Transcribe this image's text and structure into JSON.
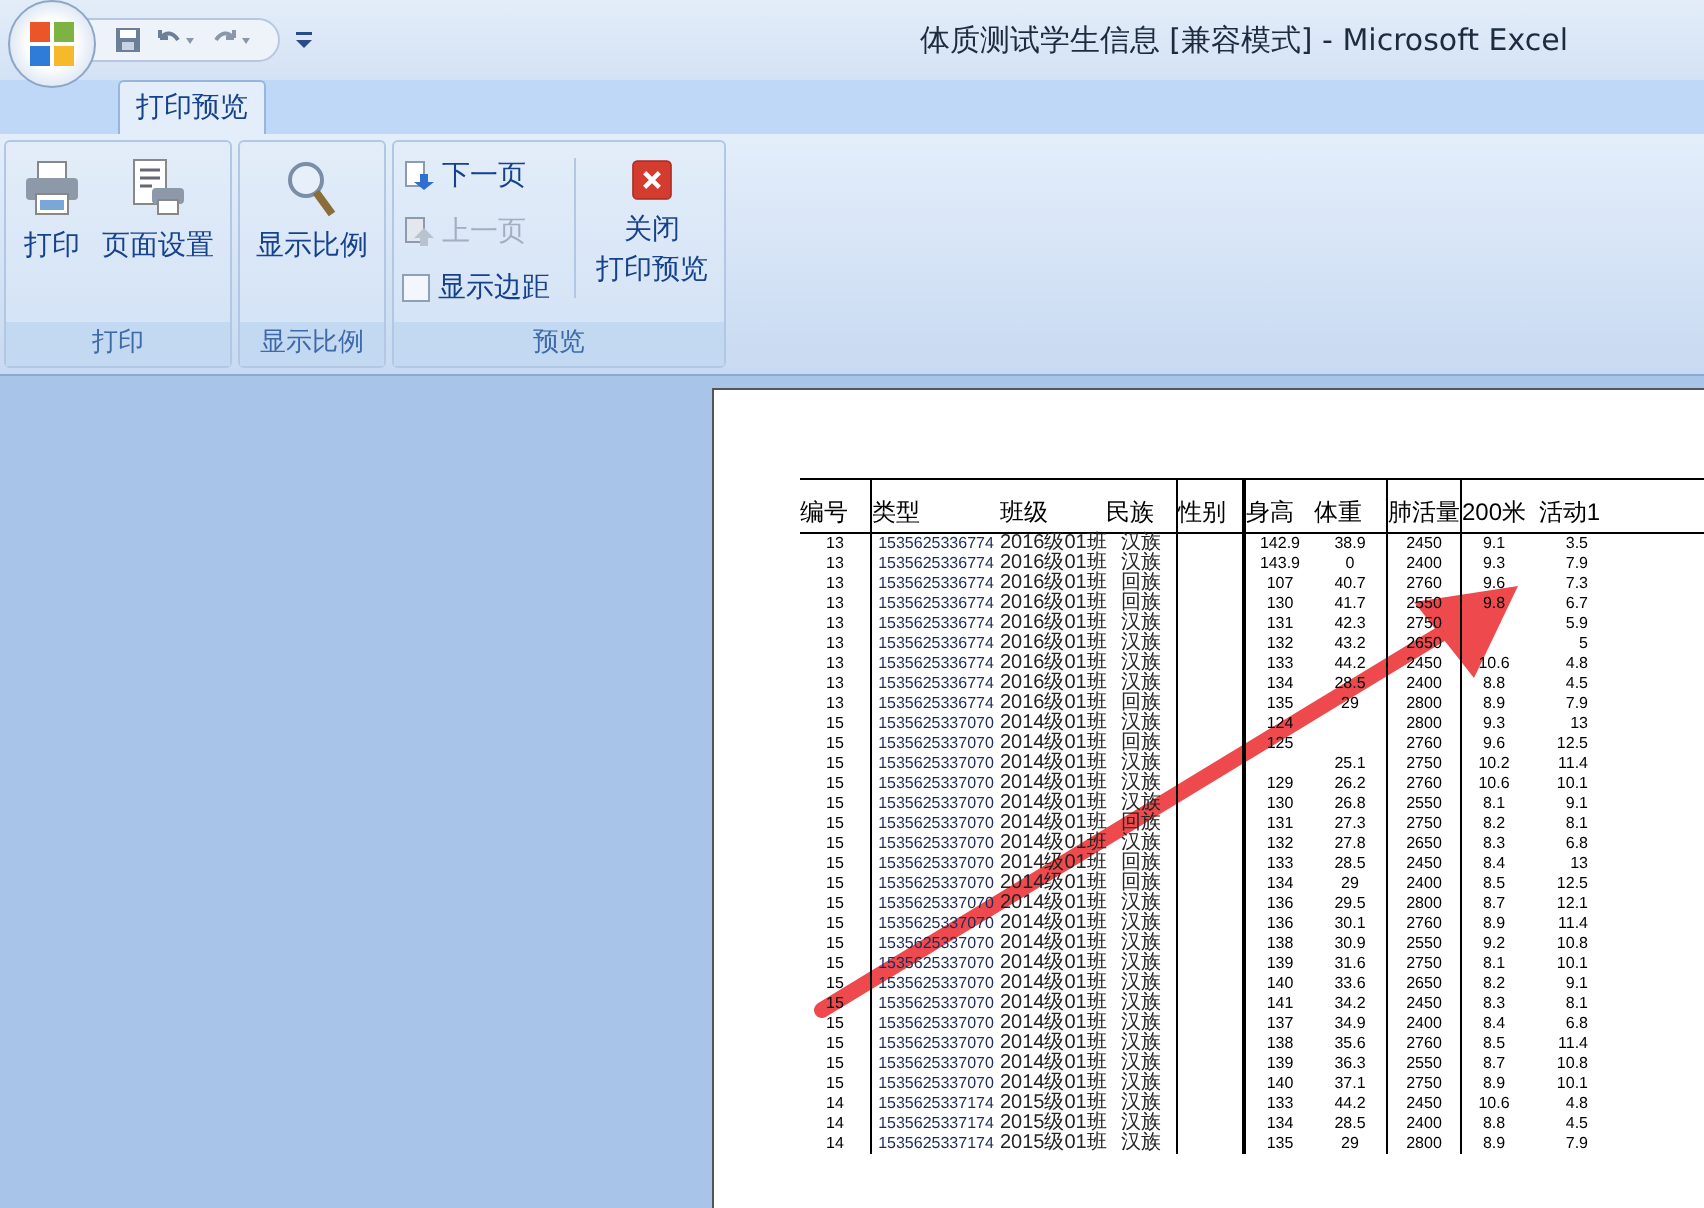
{
  "window": {
    "title": "体质测试学生信息  [兼容模式] - Microsoft Excel"
  },
  "tabs": [
    {
      "label": "打印预览",
      "selected": true
    }
  ],
  "ribbon": {
    "groups": [
      {
        "label": "打印",
        "buttons": [
          {
            "label": "打印",
            "kind": "print",
            "disabled": false
          },
          {
            "label": "页面设置",
            "kind": "page-setup",
            "disabled": false
          }
        ]
      },
      {
        "label": "显示比例",
        "buttons": [
          {
            "label": "显示比例",
            "kind": "zoom",
            "disabled": false
          }
        ]
      },
      {
        "label": "预览",
        "buttons": [
          {
            "label": "下一页",
            "kind": "next",
            "disabled": false
          },
          {
            "label": "上一页",
            "kind": "prev",
            "disabled": true
          },
          {
            "label": "显示边距",
            "kind": "checkbox",
            "checked": false
          },
          {
            "label_lines": [
              "关闭",
              "打印预览"
            ],
            "kind": "close",
            "disabled": false
          }
        ]
      }
    ]
  },
  "table": {
    "columns": [
      "编号",
      "类型",
      "班级",
      "民族",
      "性别",
      "身高",
      "体重",
      "肺活量",
      "200米",
      "活动1"
    ],
    "rows": [
      [
        "13",
        "1535625336774",
        "2016级01班",
        "汉族",
        null,
        "142.9",
        "38.9",
        "2450",
        "9.1",
        "3.5"
      ],
      [
        "13",
        "1535625336774",
        "2016级01班",
        "汉族",
        null,
        "143.9",
        "0",
        "2400",
        "9.3",
        "7.9"
      ],
      [
        "13",
        "1535625336774",
        "2016级01班",
        "回族",
        null,
        "107",
        "40.7",
        "2760",
        "9.6",
        "7.3"
      ],
      [
        "13",
        "1535625336774",
        "2016级01班",
        "回族",
        null,
        "130",
        "41.7",
        "2550",
        "9.8",
        "6.7"
      ],
      [
        "13",
        "1535625336774",
        "2016级01班",
        "汉族",
        null,
        "131",
        "42.3",
        "2750",
        null,
        "5.9"
      ],
      [
        "13",
        "1535625336774",
        "2016级01班",
        "汉族",
        null,
        "132",
        "43.2",
        "2650",
        null,
        "5"
      ],
      [
        "13",
        "1535625336774",
        "2016级01班",
        "汉族",
        null,
        "133",
        "44.2",
        "2450",
        "10.6",
        "4.8"
      ],
      [
        "13",
        "1535625336774",
        "2016级01班",
        "汉族",
        null,
        "134",
        "28.5",
        "2400",
        "8.8",
        "4.5"
      ],
      [
        "13",
        "1535625336774",
        "2016级01班",
        "回族",
        null,
        "135",
        "29",
        "2800",
        "8.9",
        "7.9"
      ],
      [
        "15",
        "1535625337070",
        "2014级01班",
        "汉族",
        null,
        "124",
        null,
        "2800",
        "9.3",
        "13"
      ],
      [
        "15",
        "1535625337070",
        "2014级01班",
        "回族",
        null,
        "125",
        null,
        "2760",
        "9.6",
        "12.5"
      ],
      [
        "15",
        "1535625337070",
        "2014级01班",
        "汉族",
        null,
        null,
        "25.1",
        "2750",
        "10.2",
        "11.4"
      ],
      [
        "15",
        "1535625337070",
        "2014级01班",
        "汉族",
        null,
        "129",
        "26.2",
        "2760",
        "10.6",
        "10.1"
      ],
      [
        "15",
        "1535625337070",
        "2014级01班",
        "汉族",
        null,
        "130",
        "26.8",
        "2550",
        "8.1",
        "9.1"
      ],
      [
        "15",
        "1535625337070",
        "2014级01班",
        "回族",
        null,
        "131",
        "27.3",
        "2750",
        "8.2",
        "8.1"
      ],
      [
        "15",
        "1535625337070",
        "2014级01班",
        "汉族",
        null,
        "132",
        "27.8",
        "2650",
        "8.3",
        "6.8"
      ],
      [
        "15",
        "1535625337070",
        "2014级01班",
        "回族",
        null,
        "133",
        "28.5",
        "2450",
        "8.4",
        "13"
      ],
      [
        "15",
        "1535625337070",
        "2014级01班",
        "回族",
        null,
        "134",
        "29",
        "2400",
        "8.5",
        "12.5"
      ],
      [
        "15",
        "1535625337070",
        "2014级01班",
        "汉族",
        null,
        "136",
        "29.5",
        "2800",
        "8.7",
        "12.1"
      ],
      [
        "15",
        "1535625337070",
        "2014级01班",
        "汉族",
        null,
        "136",
        "30.1",
        "2760",
        "8.9",
        "11.4"
      ],
      [
        "15",
        "1535625337070",
        "2014级01班",
        "汉族",
        null,
        "138",
        "30.9",
        "2550",
        "9.2",
        "10.8"
      ],
      [
        "15",
        "1535625337070",
        "2014级01班",
        "汉族",
        null,
        "139",
        "31.6",
        "2750",
        "8.1",
        "10.1"
      ],
      [
        "15",
        "1535625337070",
        "2014级01班",
        "汉族",
        null,
        "140",
        "33.6",
        "2650",
        "8.2",
        "9.1"
      ],
      [
        "15",
        "1535625337070",
        "2014级01班",
        "汉族",
        null,
        "141",
        "34.2",
        "2450",
        "8.3",
        "8.1"
      ],
      [
        "15",
        "1535625337070",
        "2014级01班",
        "汉族",
        null,
        "137",
        "34.9",
        "2400",
        "8.4",
        "6.8"
      ],
      [
        "15",
        "1535625337070",
        "2014级01班",
        "汉族",
        null,
        "138",
        "35.6",
        "2760",
        "8.5",
        "11.4"
      ],
      [
        "15",
        "1535625337070",
        "2014级01班",
        "汉族",
        null,
        "139",
        "36.3",
        "2550",
        "8.7",
        "10.8"
      ],
      [
        "15",
        "1535625337070",
        "2014级01班",
        "汉族",
        null,
        "140",
        "37.1",
        "2750",
        "8.9",
        "10.1"
      ],
      [
        "14",
        "1535625337174",
        "2015级01班",
        "汉族",
        null,
        "133",
        "44.2",
        "2450",
        "10.6",
        "4.8"
      ],
      [
        "14",
        "1535625337174",
        "2015级01班",
        "汉族",
        null,
        "134",
        "28.5",
        "2400",
        "8.8",
        "4.5"
      ],
      [
        "14",
        "1535625337174",
        "2015级01班",
        "汉族",
        null,
        "135",
        "29",
        "2800",
        "8.9",
        "7.9"
      ]
    ]
  }
}
